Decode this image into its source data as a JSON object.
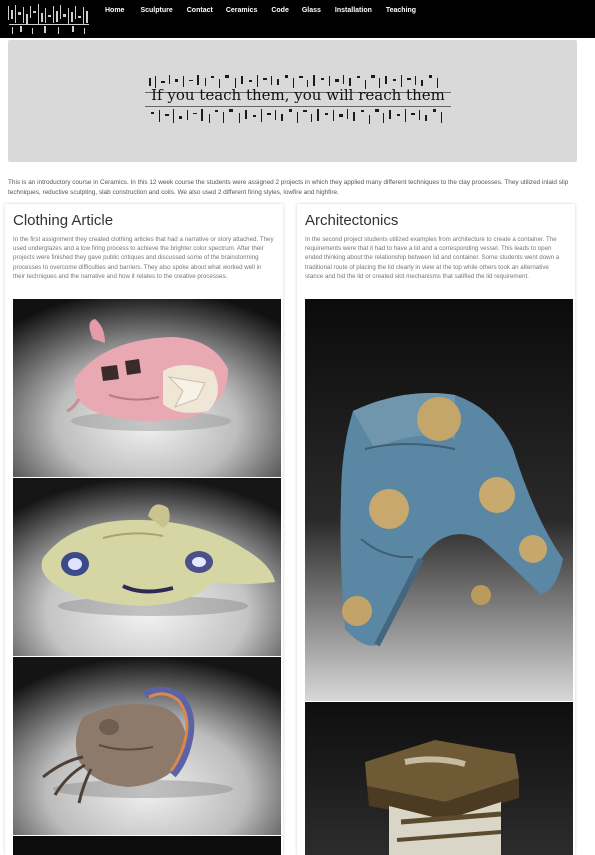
{
  "nav": {
    "items": [
      "Home",
      "Sculpture",
      "Contact",
      "Ceramics",
      "Code",
      "Glass",
      "Installation",
      "Teaching"
    ]
  },
  "banner": {
    "text": "If you teach them, you will reach them"
  },
  "intro": "This is an introductory course in Ceramics. In this 12 week course the students were assigned 2 projects in which they applied many different techniques to the clay processes. They utilized inlaid slip techniques, reductive sculpting, slab construction and coils. We also used 2 different firing styles, lowfire and highfire.",
  "projects": [
    {
      "title": "Clothing Article",
      "description": "In the first assignment they created clothing articles that had a narrative or story attached. They used underglazes and a low firing process to achieve the brighter color spectrum. After their projects were finished they gave public critiques and discussed some of the brainstorming processes to overcome difficulties and barriers. They also spoke about what worked well in their techniques and the narrative and how it relates to the creative processes."
    },
    {
      "title": "Architectonics",
      "description": "In the second project students utilized examples from architecture to create a container. The requirements were that it had to have a lid and a corresponding vessel. This leads to open ended thinking about the relationship between lid and container. Some students went down a traditional route of placing the lid clearly in view at the top while others took an alternative stance and hid the lid or created slot mechanisms that satified the lid requirement."
    }
  ]
}
